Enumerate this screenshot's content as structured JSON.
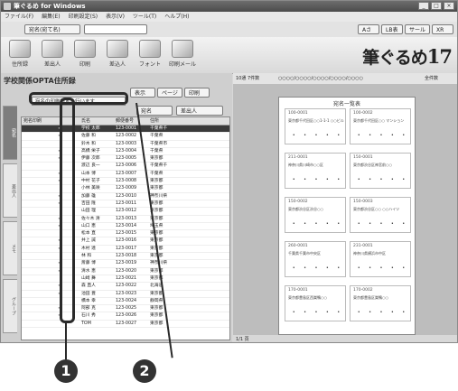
{
  "window": {
    "title": "筆ぐるめ for Windows",
    "buttons": [
      "_",
      "□",
      "×"
    ]
  },
  "menu": [
    "ファイル(F)",
    "編集(E)",
    "印刷設定(S)",
    "表示(V)",
    "ツール(T)",
    "ヘルプ(H)"
  ],
  "toolbar2": {
    "left_button": "宛名(宛て名)",
    "search_box": "",
    "right_items": [
      "Aさい",
      "LB表",
      "サール",
      "XR"
    ]
  },
  "toolbar3": {
    "tools": [
      {
        "label": "住所録",
        "icon": "address-book-icon"
      },
      {
        "label": "差出人",
        "icon": "sender-icon"
      },
      {
        "label": "印刷",
        "icon": "print-icon"
      },
      {
        "label": "差込人",
        "icon": "insert-icon"
      },
      {
        "label": "フォント",
        "icon": "font-icon"
      },
      {
        "label": "印刷メール",
        "icon": "mail-icon"
      }
    ],
    "brand": "筆ぐるめ",
    "brand_version": "17"
  },
  "left_pane": {
    "title": "学校関係OPTA住所録",
    "view_buttons": [
      "表示",
      "ページ",
      "印刷"
    ],
    "filter_box": "宛名の印刷設定を行います",
    "tabs": [
      "宛名",
      "差出人",
      "メモ",
      "グループ"
    ],
    "columns": [
      "宛名印刷",
      "",
      "",
      "",
      "",
      "氏名",
      "郵便番号",
      "住所"
    ],
    "rows": [
      {
        "name": "学校 太郎",
        "zip": "123-0001",
        "addr": "千葉県千"
      },
      {
        "name": "佐藤 和",
        "zip": "123-0002",
        "addr": "千葉県"
      },
      {
        "name": "鈴木 和",
        "zip": "123-0003",
        "addr": "千葉県市"
      },
      {
        "name": "高橋 栄子",
        "zip": "123-0004",
        "addr": "千葉県"
      },
      {
        "name": "伊藤 次郎",
        "zip": "123-0005",
        "addr": "東京都"
      },
      {
        "name": "渡辺 良一",
        "zip": "123-0006",
        "addr": "千葉県千"
      },
      {
        "name": "山本 博",
        "zip": "123-0007",
        "addr": "千葉県"
      },
      {
        "name": "中村 花子",
        "zip": "123-0008",
        "addr": "東京都"
      },
      {
        "name": "小林 美咲",
        "zip": "123-0009",
        "addr": "東京都"
      },
      {
        "name": "加藤 雄",
        "zip": "123-0010",
        "addr": "神奈川県"
      },
      {
        "name": "吉田 隆",
        "zip": "123-0011",
        "addr": "東京都"
      },
      {
        "name": "山田 理",
        "zip": "123-0012",
        "addr": "東京都"
      },
      {
        "name": "佐々木 清",
        "zip": "123-0013",
        "addr": "東京都"
      },
      {
        "name": "山口 恵",
        "zip": "123-0014",
        "addr": "埼玉県"
      },
      {
        "name": "松本 直",
        "zip": "123-0015",
        "addr": "東京都"
      },
      {
        "name": "井上 誠",
        "zip": "123-0016",
        "addr": "東京都"
      },
      {
        "name": "木村 達",
        "zip": "123-0017",
        "addr": "東京都"
      },
      {
        "name": "林 和",
        "zip": "123-0018",
        "addr": "東京都"
      },
      {
        "name": "斎藤 博",
        "zip": "123-0019",
        "addr": "神奈川県"
      },
      {
        "name": "清水 恵",
        "zip": "123-0020",
        "addr": "東京都"
      },
      {
        "name": "山崎 舞",
        "zip": "123-0021",
        "addr": "東京都"
      },
      {
        "name": "森 直人",
        "zip": "123-0022",
        "addr": "北海道"
      },
      {
        "name": "池田 豊",
        "zip": "123-0023",
        "addr": "東京都"
      },
      {
        "name": "橋本 幸",
        "zip": "123-0024",
        "addr": "静岡県"
      },
      {
        "name": "阿部 克",
        "zip": "123-0025",
        "addr": "東京都"
      },
      {
        "name": "石川 秀",
        "zip": "123-0026",
        "addr": "東京都"
      },
      {
        "name": "TOM",
        "zip": "123-0027",
        "addr": "東京都"
      }
    ]
  },
  "right_pane": {
    "bar": [
      "10通 7件数",
      "○○○○/○○○○/○○○○/○○○○/○○○○",
      "全件数"
    ],
    "paper_title": "宛名一覧表",
    "cards": [
      {
        "zip": "100-0001",
        "addr": "東京都千代田区○○1-1-1 ○○ビル"
      },
      {
        "zip": "100-0002",
        "addr": "東京都千代田区○○ マンション"
      },
      {
        "zip": "211-0001",
        "addr": "神奈川県川崎市○○区"
      },
      {
        "zip": "150-0001",
        "addr": "東京都渋谷区神宮前○○"
      },
      {
        "zip": "150-0002",
        "addr": "東京都渋谷区渋谷○○"
      },
      {
        "zip": "150-0003",
        "addr": "東京都渋谷区○○ ○○ハイツ"
      },
      {
        "zip": "260-0001",
        "addr": "千葉県千葉市中央区"
      },
      {
        "zip": "231-0001",
        "addr": "神奈川県横浜市中区"
      },
      {
        "zip": "170-0001",
        "addr": "東京都豊島区西巣鴨○○"
      },
      {
        "zip": "170-0002",
        "addr": "東京都豊島区巣鴨○○"
      }
    ],
    "status": "1/1 頁"
  },
  "callouts": [
    "1",
    "2"
  ]
}
